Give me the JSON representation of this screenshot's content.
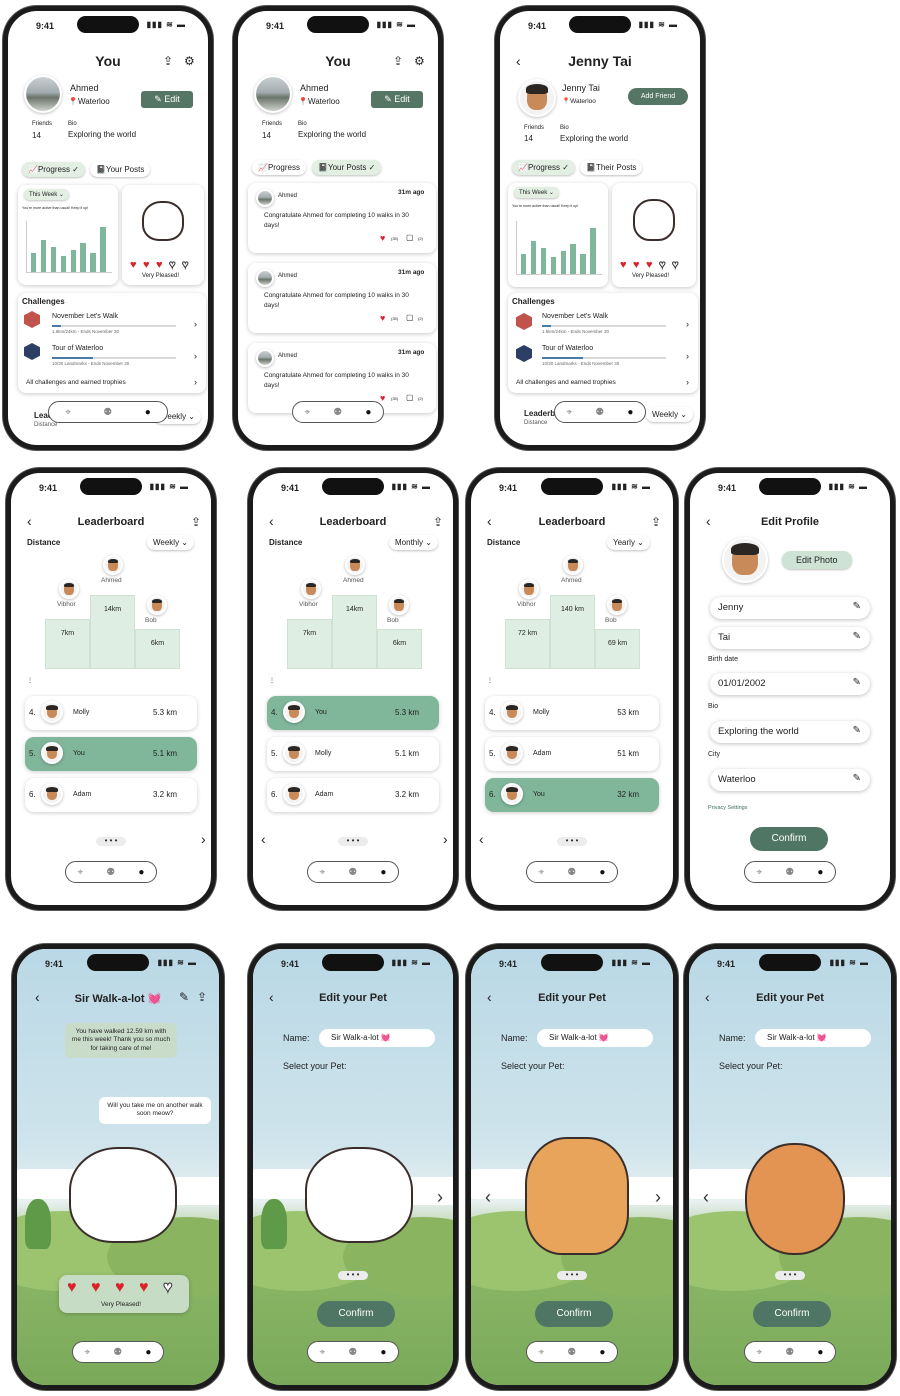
{
  "status": {
    "time": "9:41",
    "indicators": "▮▮▮ ≋ ▬"
  },
  "nav": {
    "map": "⌖",
    "friends": "⚉",
    "profile": "●"
  },
  "p1": {
    "title": "You",
    "name": "Ahmed",
    "location": "📍Waterloo",
    "edit": "✎ Edit",
    "friends_label": "Friends",
    "friends": "14",
    "bio_label": "Bio",
    "bio": "Exploring the world",
    "tab_progress": "📈Progress ✓",
    "tab_posts": "📓Your Posts",
    "week": "This Week ⌄",
    "msg": "You're more active than usual! Keep it up!",
    "pleased": "Very Pleased!",
    "challenges": "Challenges",
    "c1": "November Let's Walk",
    "c1sub": "1.6km/24km - Ends November 30",
    "c2": "Tour of Waterloo",
    "c2sub": "10/30 Landmarks - Ends November 30",
    "all": "All challenges and earned trophies",
    "lb": "Leaderb",
    "dist": "Distance",
    "weekly": "Weekly ⌄"
  },
  "p2": {
    "title": "You",
    "name": "Ahmed",
    "location": "📍Waterloo",
    "edit": "✎ Edit",
    "friends_label": "Friends",
    "friends": "14",
    "bio_label": "Bio",
    "bio": "Exploring the world",
    "tab_progress": "📈Progress",
    "tab_posts": "📓Your Posts ✓",
    "posts": [
      {
        "who": "Ahmed",
        "time": "31m ago",
        "text": "Congratulate Ahmed for completing 10 walks in 30 days!",
        "likes": "(35)",
        "comments": "(2)"
      },
      {
        "who": "Ahmed",
        "time": "31m ago",
        "text": "Congratulate Ahmed for completing 10 walks in 30 days!",
        "likes": "(35)",
        "comments": "(2)"
      },
      {
        "who": "Ahmed",
        "time": "31m ago",
        "text": "Congratulate Ahmed for completing 10 walks in 30 days!",
        "likes": "(35)",
        "comments": "(2)"
      }
    ]
  },
  "p3": {
    "title": "Jenny Tai",
    "name": "Jenny Tai",
    "location": "📍Waterloo",
    "add": "Add Friend",
    "friends_label": "Friends",
    "friends": "14",
    "bio_label": "Bio",
    "bio": "Exploring the world",
    "tab_progress": "📈Progress ✓",
    "tab_posts": "📓Their Posts",
    "week": "This Week ⌄",
    "msg": "You're more active than usual! Keep it up!",
    "pleased": "Very Pleased!",
    "challenges": "Challenges",
    "c1": "November Let's Walk",
    "c1sub": "1.6km/24km - Ends November 30",
    "c2": "Tour of Waterloo",
    "c2sub": "10/30 Landmarks - Ends November 30",
    "all": "All challenges and earned trophies",
    "lb": "Leaderb",
    "dist": "Distance",
    "weekly": "Weekly ⌄"
  },
  "lb": [
    {
      "title": "Leaderboard",
      "dist": "Distance",
      "period": "Weekly ⌄",
      "podium": [
        {
          "n": "Vibhor",
          "v": "7km"
        },
        {
          "n": "Ahmed",
          "v": "14km"
        },
        {
          "n": "Bob",
          "v": "6km"
        }
      ],
      "rows": [
        {
          "r": "4.",
          "n": "Molly",
          "v": "5.3 km",
          "hl": false
        },
        {
          "r": "5.",
          "n": "You",
          "v": "5.1 km",
          "hl": true
        },
        {
          "r": "6.",
          "n": "Adam",
          "v": "3.2 km",
          "hl": false
        }
      ]
    },
    {
      "title": "Leaderboard",
      "dist": "Distance",
      "period": "Monthly ⌄",
      "podium": [
        {
          "n": "Vibhor",
          "v": "7km"
        },
        {
          "n": "Ahmed",
          "v": "14km"
        },
        {
          "n": "Bob",
          "v": "6km"
        }
      ],
      "rows": [
        {
          "r": "4.",
          "n": "You",
          "v": "5.3 km",
          "hl": true
        },
        {
          "r": "5.",
          "n": "Molly",
          "v": "5.1 km",
          "hl": false
        },
        {
          "r": "6.",
          "n": "Adam",
          "v": "3.2 km",
          "hl": false
        }
      ]
    },
    {
      "title": "Leaderboard",
      "dist": "Distance",
      "period": "Yearly ⌄",
      "podium": [
        {
          "n": "Vibhor",
          "v": "72 km"
        },
        {
          "n": "Ahmed",
          "v": "140 km"
        },
        {
          "n": "Bob",
          "v": "69 km"
        }
      ],
      "rows": [
        {
          "r": "4.",
          "n": "Molly",
          "v": "53 km",
          "hl": false
        },
        {
          "r": "5.",
          "n": "Adam",
          "v": "51 km",
          "hl": false
        },
        {
          "r": "6.",
          "n": "You",
          "v": "32 km",
          "hl": true
        }
      ]
    }
  ],
  "edit": {
    "title": "Edit Profile",
    "photo": "Edit Photo",
    "first": "Jenny",
    "last": "Tai",
    "birth_label": "Birth date",
    "birth": "01/01/2002",
    "bio_label": "Bio",
    "bio": "Exploring the world",
    "city_label": "City",
    "city": "Waterloo",
    "privacy": "Privacy Settings",
    "confirm": "Confirm"
  },
  "pet": {
    "title": "Sir Walk-a-lot 💓",
    "b1": "You have walked 12.59 km with me this week! Thank you so much for taking care of me!",
    "b2": "Will you take me on another walk soon meow?",
    "pleased": "Very Pleased!"
  },
  "editpet": {
    "title": "Edit your Pet",
    "name_label": "Name:",
    "name": "Sir Walk-a-lot 💓",
    "select": "Select your Pet:",
    "confirm": "Confirm"
  },
  "chart_week": {
    "type": "bar",
    "values": [
      6,
      10,
      8,
      5,
      7,
      9,
      6,
      14
    ],
    "ylim": [
      0,
      16
    ]
  }
}
